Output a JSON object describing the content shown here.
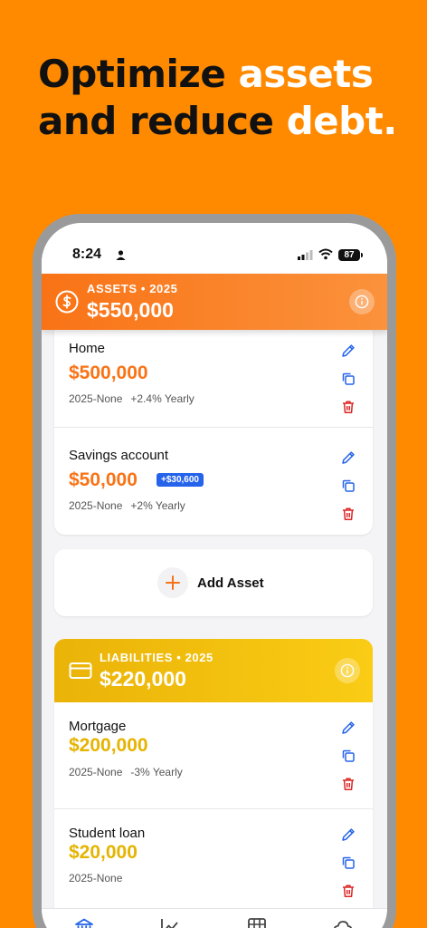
{
  "headline": {
    "part1": "Optimize ",
    "part2": "assets",
    "part3": "and reduce ",
    "part4": "debt."
  },
  "status_bar": {
    "time": "8:24",
    "battery": "87"
  },
  "assets": {
    "header_label": "ASSETS • 2025",
    "total": "$550,000",
    "items": [
      {
        "name": "Home",
        "amount": "$500,000",
        "range": "2025-None",
        "growth": "+2.4% Yearly",
        "badge": ""
      },
      {
        "name": "Savings account",
        "amount": "$50,000",
        "range": "2025-None",
        "growth": "+2% Yearly",
        "badge": "+$30,600"
      }
    ],
    "add_label": "Add Asset"
  },
  "liabilities": {
    "header_label": "LIABILITIES • 2025",
    "total": "$220,000",
    "items": [
      {
        "name": "Mortgage",
        "amount": "$200,000",
        "range": "2025-None",
        "growth": "-3% Yearly"
      },
      {
        "name": "Student loan",
        "amount": "$20,000",
        "range": "2025-None",
        "growth": ""
      }
    ]
  },
  "colors": {
    "background": "#FF8A00",
    "asset_accent": "#F97316",
    "liability_accent": "#EAB308",
    "badge": "#2563EB",
    "edit": "#2563EB",
    "delete": "#DC2626"
  },
  "icons": [
    "dollar-coin-icon",
    "credit-card-icon",
    "info-icon",
    "pencil-icon",
    "copy-icon",
    "trash-icon",
    "plus-icon",
    "bank-icon",
    "chart-icon",
    "table-icon",
    "cloud-icon"
  ]
}
